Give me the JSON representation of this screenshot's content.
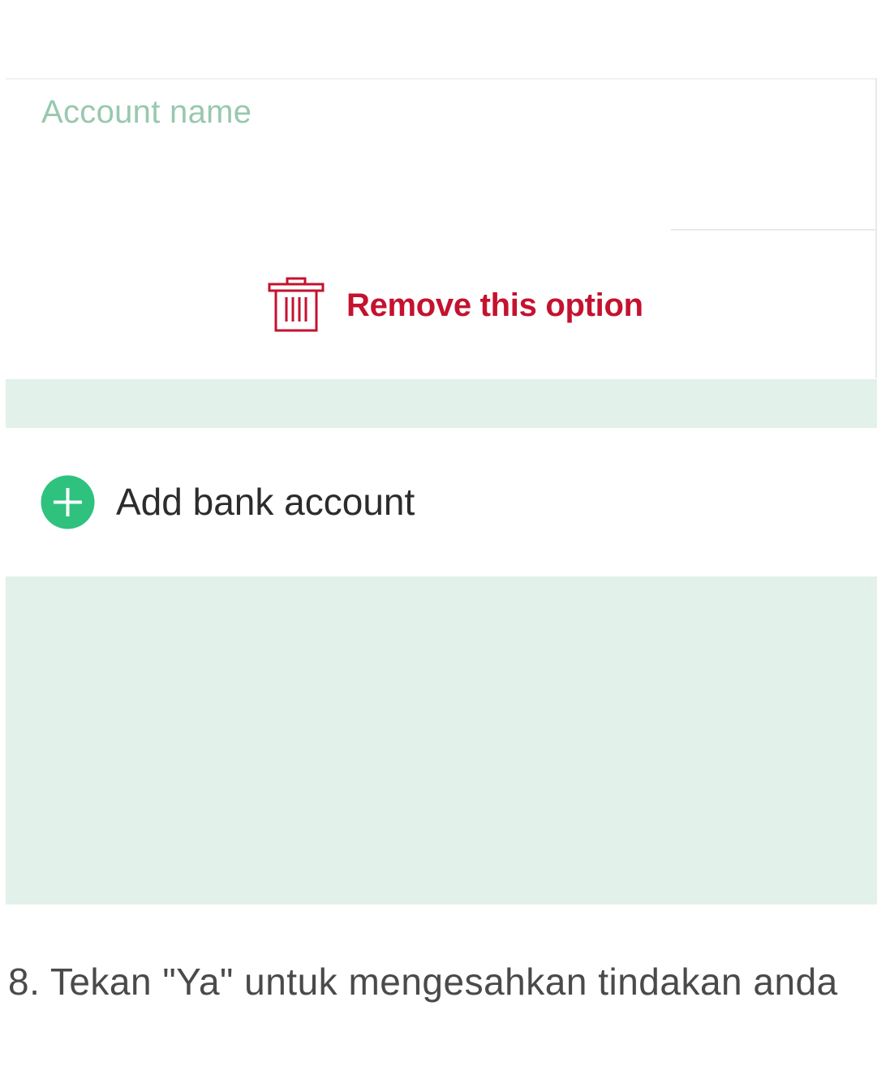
{
  "form": {
    "account_name_label": "Account name",
    "remove_option_label": "Remove this option",
    "add_bank_account_label": "Add bank account"
  },
  "icons": {
    "remove": "trash-icon",
    "add": "plus-circle-icon"
  },
  "colors": {
    "label_green": "#98c8ae",
    "remove_red": "#c4122f",
    "add_green": "#2ec27e",
    "band_mint": "#e2f1ea"
  },
  "caption": {
    "text": "8. Tekan \"Ya\" untuk mengesahkan tindakan anda"
  }
}
